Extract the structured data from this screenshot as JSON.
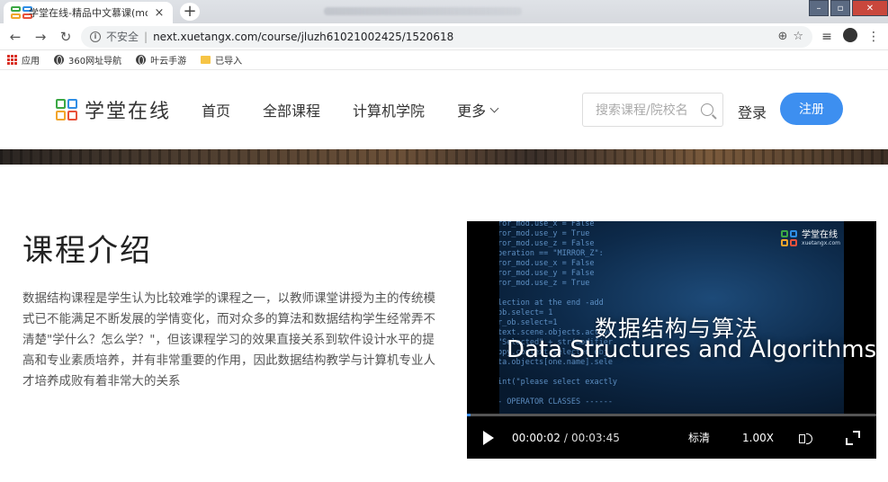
{
  "browser": {
    "tab_title": "学堂在线-精品中文慕课(mooc)平",
    "tab_close": "×",
    "new_tab": "+",
    "url_security": "不安全",
    "url_separator": "|",
    "url": "next.xuetangx.com/course/jluzh61021002425/1520618",
    "bookmarks": [
      {
        "label": "应用",
        "icon": "apps-icon"
      },
      {
        "label": "360网址导航",
        "icon": "globe-icon"
      },
      {
        "label": "叶云手游",
        "icon": "globe-icon"
      },
      {
        "label": "已导入",
        "icon": "folder-icon"
      }
    ],
    "icons": [
      "back-icon",
      "forward-icon",
      "reload-icon",
      "zoom-icon",
      "star-icon",
      "reading-list-icon",
      "profile-icon",
      "menu-icon"
    ]
  },
  "site": {
    "logo_text": "学堂在线",
    "nav": [
      "首页",
      "全部课程",
      "计算机学院",
      "更多"
    ],
    "search_placeholder": "搜索课程/院校名",
    "login": "登录",
    "register": "注册"
  },
  "course": {
    "section_title": "课程介绍",
    "intro": "数据结构课程是学生认为比较难学的课程之一，以教师课堂讲授为主的传统模式已不能满足不断发展的学情变化，而对众多的算法和数据结构学生经常弄不清楚\"学什么？怎么学？\"，但该课程学习的效果直接关系到软件设计水平的提高和专业素质培养，并有非常重要的作用，因此数据结构教学与计算机专业人才培养成败有着非常大的关系"
  },
  "video": {
    "logo_text": "学堂在线",
    "logo_sub": "xuetangx.com",
    "title_cn": "数据结构与算法",
    "title_en": "Data Structures and Algorithms",
    "current_time": "00:00:02",
    "time_separator": "/",
    "duration": "00:03:45",
    "quality": "标清",
    "speed": "1.00X",
    "progress": 0.009
  },
  "colors": {
    "accent": "#3d8ff0"
  }
}
